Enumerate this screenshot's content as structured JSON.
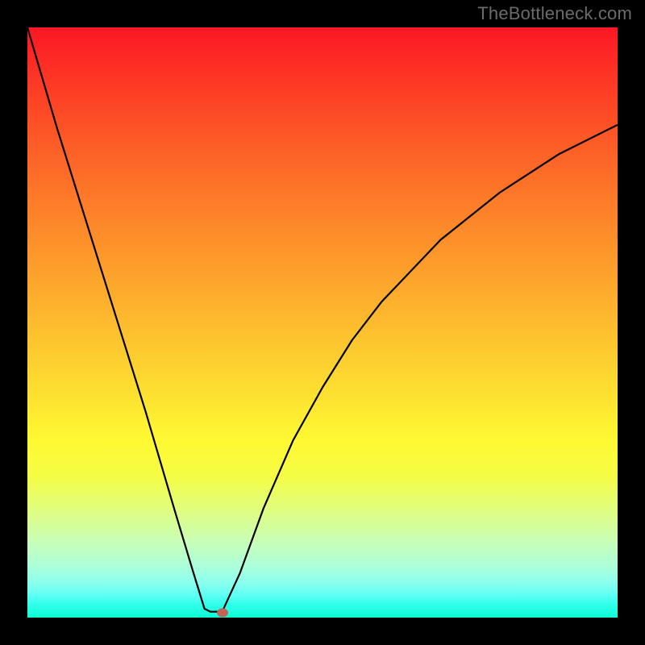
{
  "watermark": "TheBottleneck.com",
  "chart_data": {
    "type": "line",
    "title": "",
    "xlabel": "",
    "ylabel": "",
    "xlim": [
      0,
      1
    ],
    "ylim": [
      0,
      1
    ],
    "grid": false,
    "legend": false,
    "series": [
      {
        "name": "bottleneck-curve",
        "x": [
          0.0,
          0.05,
          0.1,
          0.15,
          0.2,
          0.25,
          0.28,
          0.3,
          0.31,
          0.33,
          0.36,
          0.4,
          0.45,
          0.5,
          0.55,
          0.6,
          0.7,
          0.8,
          0.9,
          1.0
        ],
        "y": [
          1.0,
          0.83,
          0.67,
          0.51,
          0.35,
          0.18,
          0.08,
          0.015,
          0.01,
          0.01,
          0.075,
          0.185,
          0.3,
          0.39,
          0.47,
          0.535,
          0.64,
          0.72,
          0.785,
          0.835
        ]
      }
    ],
    "marker": {
      "name": "optimal-point",
      "x": 0.33,
      "y": 0.008,
      "color": "#c46158"
    },
    "gradient": {
      "top_color": "#fc1723",
      "bottom_color": "#0affd6"
    }
  }
}
